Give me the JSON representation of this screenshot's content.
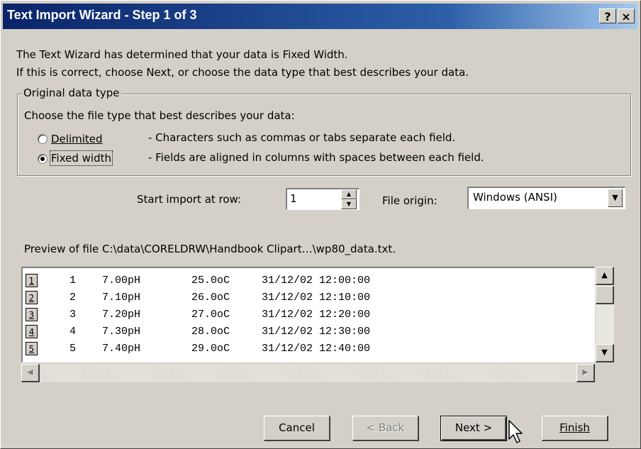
{
  "window": {
    "title": "Text Import Wizard - Step 1 of 3",
    "help_glyph": "?",
    "close_glyph": "×"
  },
  "intro": {
    "line1": "The Text Wizard has determined that your data is Fixed Width.",
    "line2": "If this is correct, choose Next, or choose the data type that best describes your data."
  },
  "data_type_group": {
    "legend": "Original data type",
    "prompt": "Choose the file type that best describes your data:",
    "options": [
      {
        "label": "Delimited",
        "description": "- Characters such as commas or tabs separate each field.",
        "selected": false
      },
      {
        "label": "Fixed width",
        "description": "- Fields are aligned in columns with spaces between each field.",
        "selected": true
      }
    ]
  },
  "import_options": {
    "start_row_label": "Start import at row:",
    "start_row_value": "1",
    "file_origin_label": "File origin:",
    "file_origin_value": "Windows (ANSI)"
  },
  "preview": {
    "label": "Preview of file C:\\data\\CORELDRW\\Handbook Clipart…\\wp80_data.txt.",
    "rows": [
      {
        "num": "1",
        "cells": [
          "1",
          "7.00pH",
          "25.0oC",
          "31/12/02 12:00:00"
        ]
      },
      {
        "num": "2",
        "cells": [
          "2",
          "7.10pH",
          "26.0oC",
          "31/12/02 12:10:00"
        ]
      },
      {
        "num": "3",
        "cells": [
          "3",
          "7.20pH",
          "27.0oC",
          "31/12/02 12:20:00"
        ]
      },
      {
        "num": "4",
        "cells": [
          "4",
          "7.30pH",
          "28.0oC",
          "31/12/02 12:30:00"
        ]
      },
      {
        "num": "5",
        "cells": [
          "5",
          "7.40pH",
          "29.0oC",
          "31/12/02 12:40:00"
        ]
      }
    ]
  },
  "buttons": {
    "cancel": "Cancel",
    "back": "< Back",
    "next": "Next >",
    "finish": "Finish"
  },
  "icons": [
    "help-icon",
    "close-icon",
    "spin-up-icon",
    "spin-down-icon",
    "dropdown-arrow-icon",
    "scroll-up-icon",
    "scroll-down-icon",
    "scroll-left-icon",
    "scroll-right-icon",
    "mouse-cursor-icon"
  ]
}
